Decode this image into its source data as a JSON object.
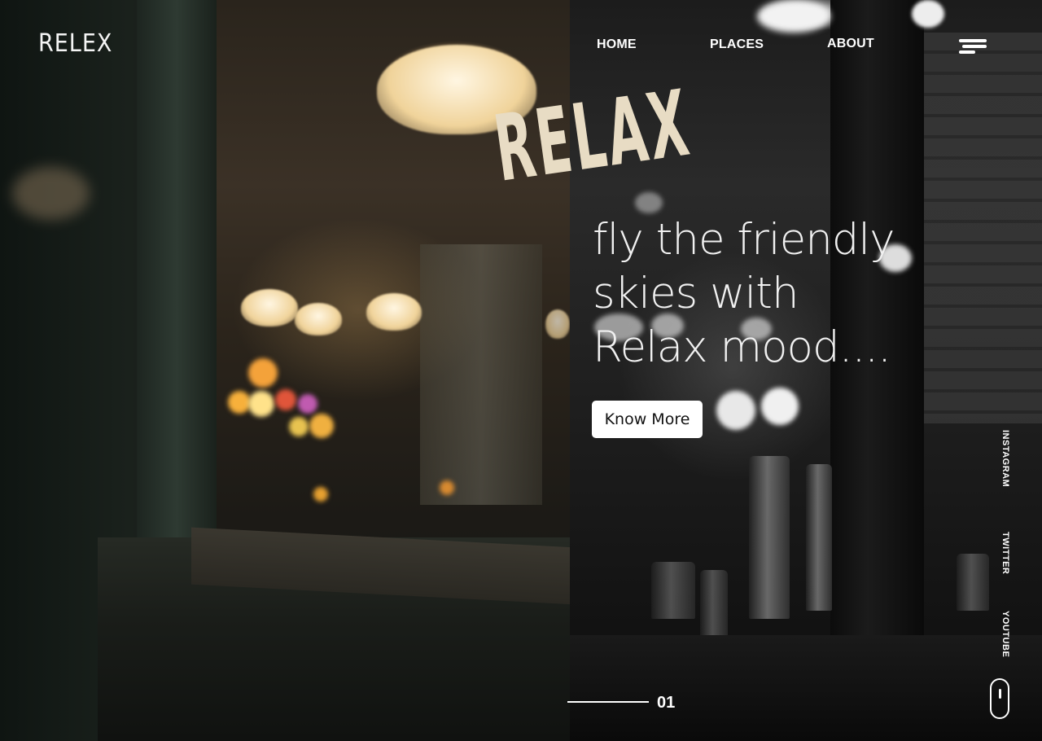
{
  "brand": {
    "logo_text": "RELEX"
  },
  "nav": {
    "items": [
      {
        "label": "HOME"
      },
      {
        "label": "PLACES"
      },
      {
        "label": "ABOUT"
      }
    ],
    "menu_icon": "hamburger-menu-icon"
  },
  "hero": {
    "title_lines": [
      "fly  the  friendly",
      "skies with",
      "Relax mood...."
    ],
    "cta_label": "Know More"
  },
  "scene": {
    "window_lettering": "RELAX"
  },
  "social": {
    "links": [
      {
        "label": "INSTAGRAM"
      },
      {
        "label": "TWITTER"
      },
      {
        "label": "YOUTUBE"
      }
    ]
  },
  "slider": {
    "current": "01",
    "scroll_icon": "mouse-scroll-icon"
  },
  "colors": {
    "text": "#ffffff",
    "button_bg": "#ffffff",
    "button_text": "#111111"
  }
}
